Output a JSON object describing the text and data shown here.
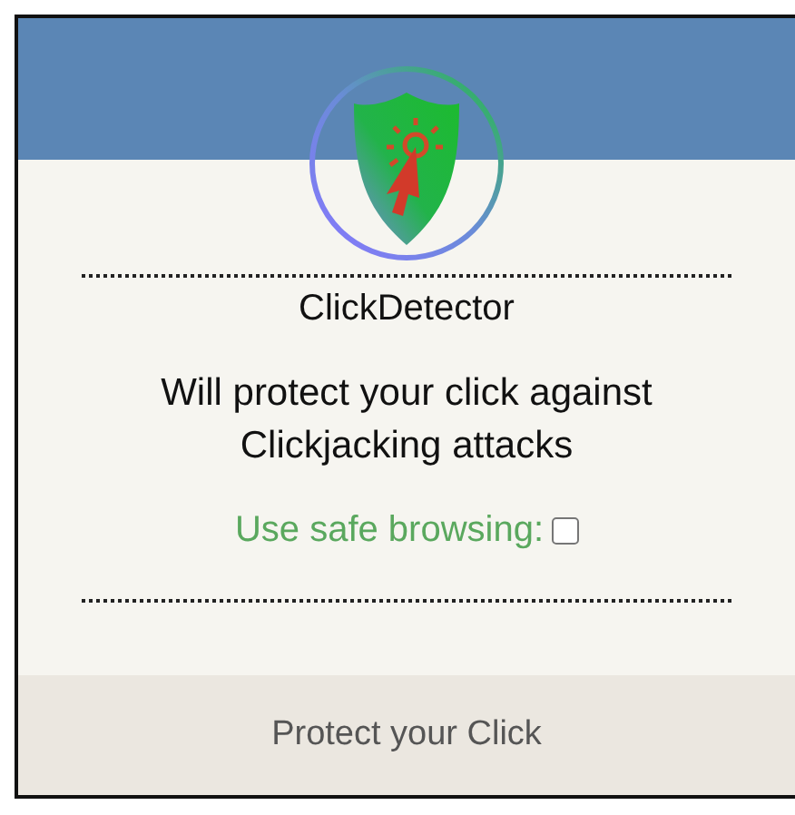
{
  "title": "ClickDetector",
  "description": "Will protect your click against Clickjacking attacks",
  "safe_browsing": {
    "label": "Use safe browsing:",
    "checked": false
  },
  "footer": "Protect your Click"
}
